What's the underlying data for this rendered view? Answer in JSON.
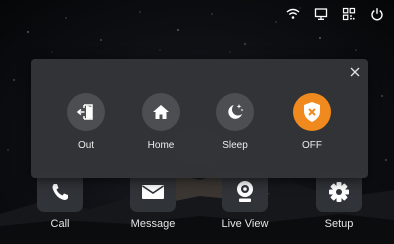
{
  "status_bar": {
    "icons": [
      "wifi-icon",
      "monitor-icon",
      "qr-code-icon",
      "power-icon"
    ]
  },
  "dock": {
    "items": [
      {
        "label": "Call",
        "icon": "phone-icon"
      },
      {
        "label": "Message",
        "icon": "envelope-icon"
      },
      {
        "label": "Live View",
        "icon": "camera-icon"
      },
      {
        "label": "Setup",
        "icon": "gear-icon"
      }
    ]
  },
  "mode_popup": {
    "close_icon": "close-icon",
    "modes": [
      {
        "label": "Out",
        "icon": "exit-door-icon",
        "active": false
      },
      {
        "label": "Home",
        "icon": "home-icon",
        "active": false
      },
      {
        "label": "Sleep",
        "icon": "moon-stars-icon",
        "active": false
      },
      {
        "label": "OFF",
        "icon": "shield-off-icon",
        "active": true
      }
    ]
  },
  "colors": {
    "accent": "#f08a1e",
    "popup_bg": "#343538",
    "mode_circle": "#4c4e52",
    "dock_tile": "#303338",
    "text": "#e6e6e6"
  }
}
